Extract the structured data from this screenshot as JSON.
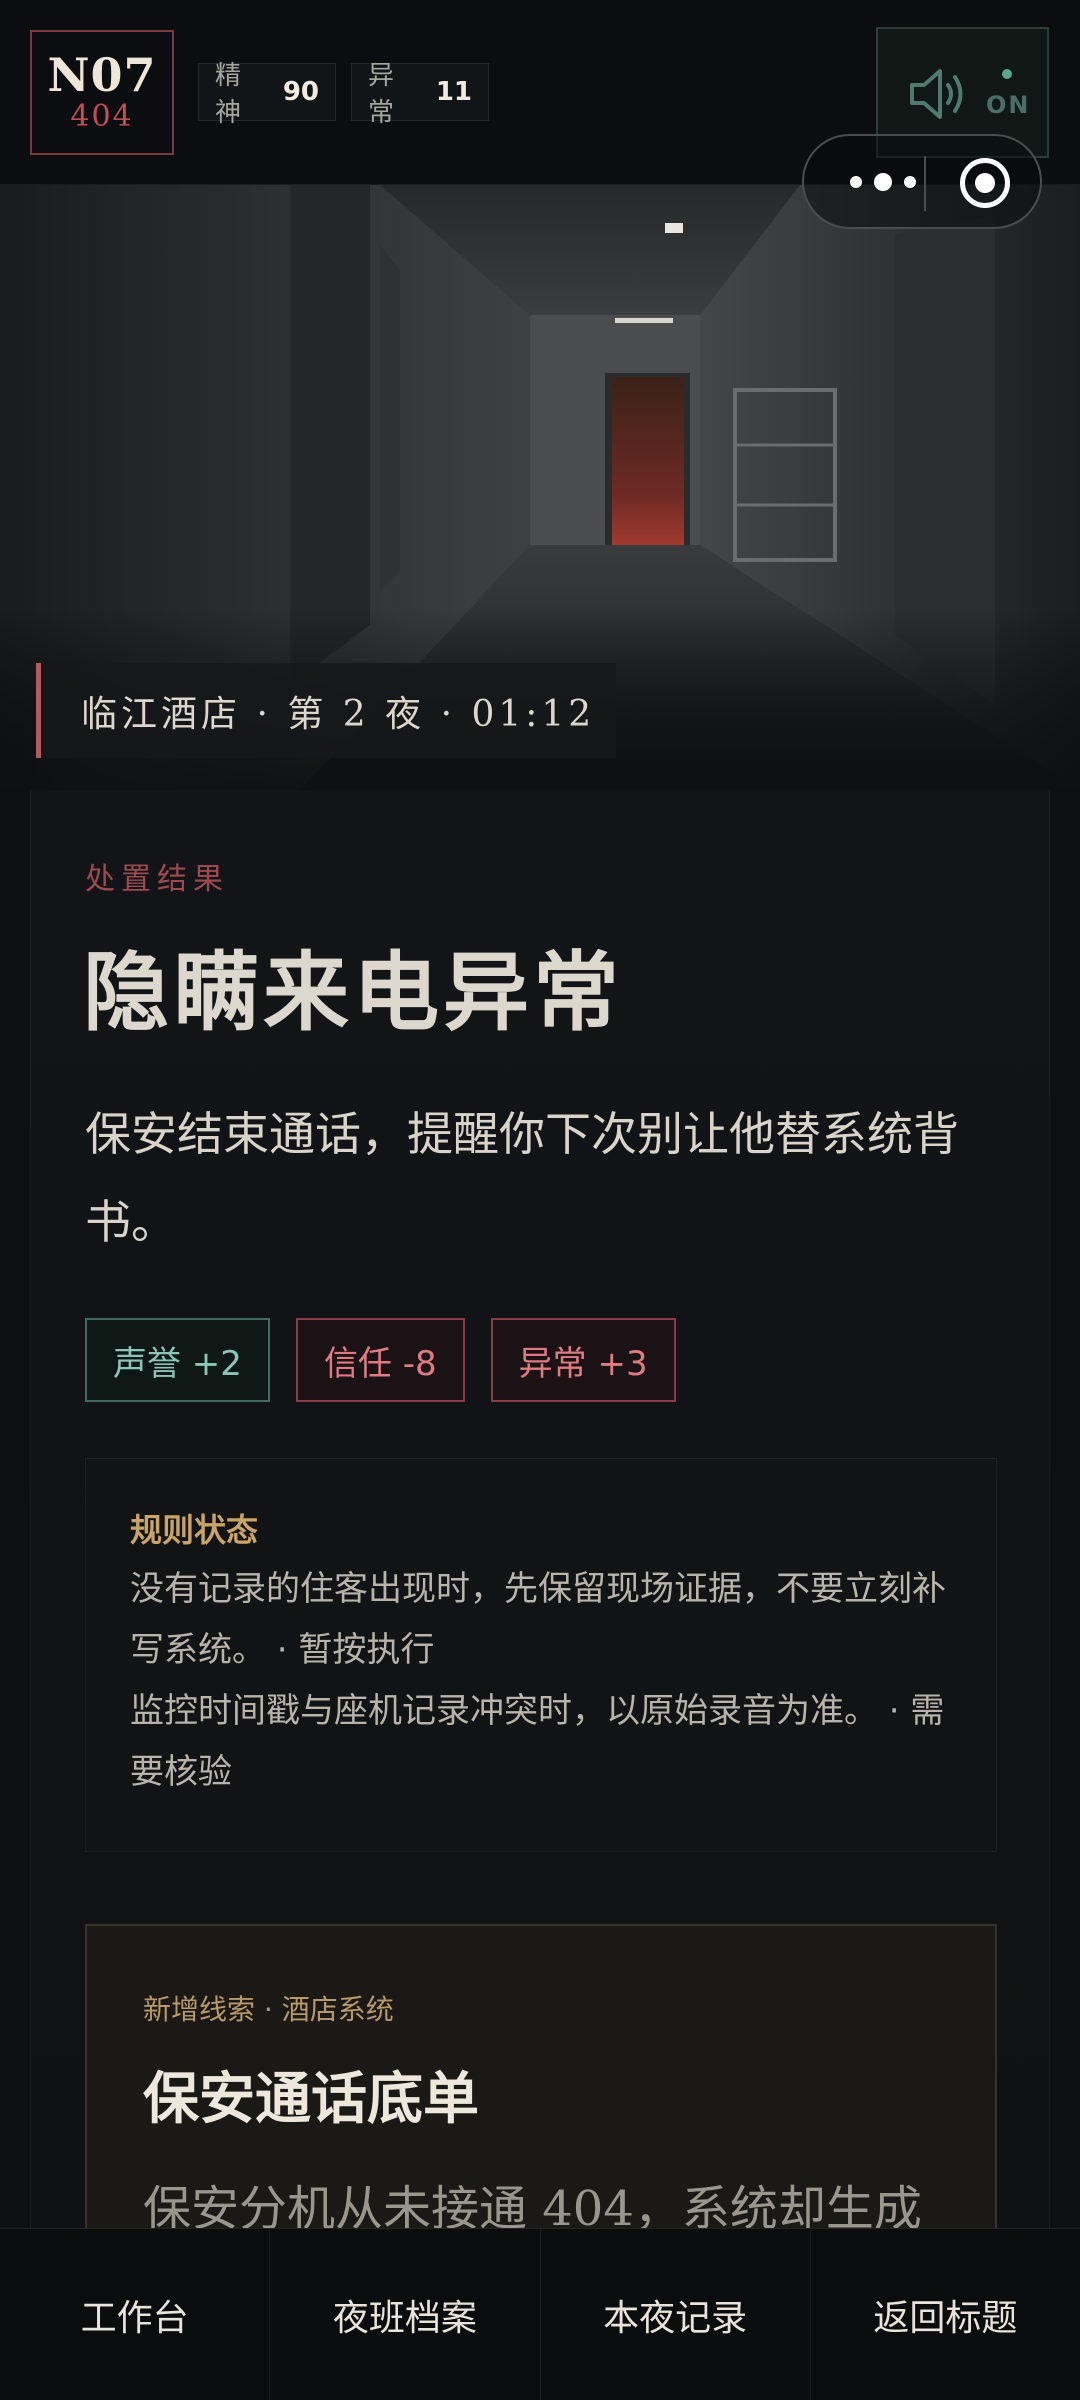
{
  "header": {
    "logo_code": "N07",
    "logo_num": "404",
    "stats": [
      {
        "label": "精神",
        "value": "90"
      },
      {
        "label": "异常",
        "value": "11"
      }
    ],
    "sound": {
      "state": "ON",
      "icon": "speaker-icon"
    }
  },
  "capsule": {
    "more_icon": "more-dots-icon",
    "close_icon": "target-close-icon"
  },
  "hero": {
    "location": "临江酒店 · 第 2 夜 · 01:12"
  },
  "result": {
    "eyebrow": "处置结果",
    "title": "隐瞒来电异常",
    "description": "保安结束通话，提醒你下次别让他替系统背书。",
    "effects": [
      {
        "label": "声誉 +2",
        "tone": "teal"
      },
      {
        "label": "信任 -8",
        "tone": "red"
      },
      {
        "label": "异常 +3",
        "tone": "red"
      }
    ],
    "rules": {
      "title": "规则状态",
      "lines": [
        "没有记录的住客出现时，先保留现场证据，不要立刻补写系统。 · 暂按执行",
        "监控时间戳与座机记录冲突时，以原始录音为准。 · 需要核验"
      ]
    },
    "clue": {
      "tag": "新增线索 · 酒店系统",
      "title": "保安通话底单",
      "text": "保安分机从未接通 404，系统却生成"
    }
  },
  "nav": {
    "items": [
      "工作台",
      "夜班档案",
      "本夜记录",
      "返回标题"
    ]
  },
  "colors": {
    "accent_red": "#c24d54",
    "accent_teal": "#5aa892",
    "accent_gold": "#c9a467",
    "background": "#0d0f11"
  }
}
